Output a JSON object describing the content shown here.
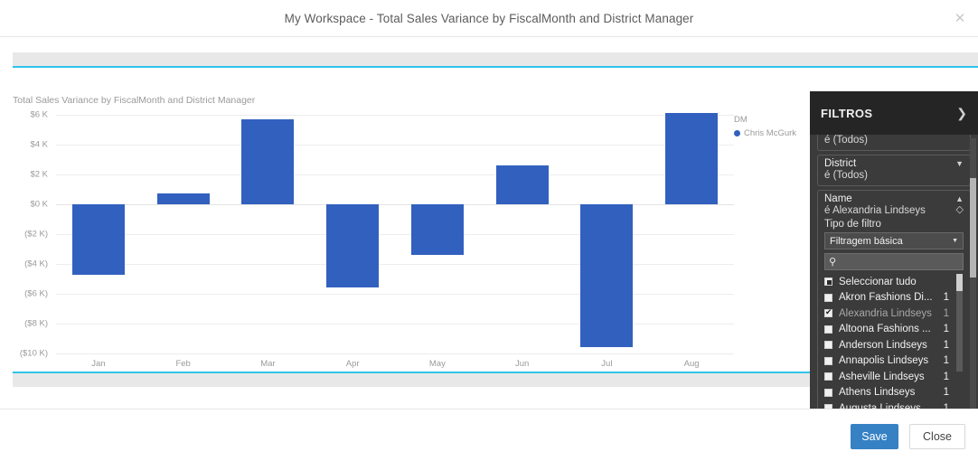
{
  "window": {
    "title": "My Workspace - Total Sales Variance by FiscalMonth and District Manager",
    "close_icon": "close-icon"
  },
  "visual": {
    "title": "Total Sales Variance by FiscalMonth and District Manager"
  },
  "chart_data": {
    "type": "bar",
    "title": "Total Sales Variance by FiscalMonth and District Manager",
    "xlabel": "",
    "ylabel": "",
    "categories": [
      "Jan",
      "Feb",
      "Mar",
      "Apr",
      "May",
      "Jun",
      "Jul",
      "Aug"
    ],
    "series": [
      {
        "name": "Chris McGurk",
        "color": "#3260bf",
        "values": [
          -4750,
          730,
          5700,
          -5550,
          -3400,
          2600,
          -9600,
          6100
        ]
      }
    ],
    "ylim": [
      -10000,
      6000
    ],
    "ytick_values": [
      6000,
      4000,
      2000,
      0,
      -2000,
      -4000,
      -6000,
      -8000,
      -10000
    ],
    "ytick_labels": [
      "$6 K",
      "$4 K",
      "$2 K",
      "$0 K",
      "($2 K)",
      "($4 K)",
      "($6 K)",
      "($8 K)",
      "($10 K)"
    ],
    "grid": true,
    "legend_position": "right",
    "legend_title": "DM",
    "legend_entries": [
      "Chris McGurk"
    ]
  },
  "filters": {
    "header_title": "FILTROS",
    "collapse_icon": "chevron-right-icon",
    "cards": [
      {
        "name": "",
        "value": "é (Todos)",
        "chevron": "",
        "clipped": true
      },
      {
        "name": "District",
        "value": "é (Todos)",
        "chevron": "chevron-down-icon",
        "clipped": false
      }
    ],
    "active_card": {
      "name": "Name",
      "value": "é Alexandria Lindseys",
      "chevron": "chevron-up-icon",
      "clear_icon": "eraser-icon",
      "filter_type_label": "Tipo de filtro",
      "filter_type_value": "Filtragem básica",
      "search_placeholder": "",
      "search_value": "",
      "search_icon": "search-icon",
      "items": [
        {
          "label": "Seleccionar tudo",
          "count": "",
          "state": "partial",
          "dim": false
        },
        {
          "label": "Akron Fashions Di...",
          "count": "1",
          "state": "unchecked",
          "dim": false
        },
        {
          "label": "Alexandria Lindseys",
          "count": "1",
          "state": "checked",
          "dim": true
        },
        {
          "label": "Altoona Fashions ...",
          "count": "1",
          "state": "unchecked",
          "dim": false
        },
        {
          "label": "Anderson Lindseys",
          "count": "1",
          "state": "unchecked",
          "dim": false
        },
        {
          "label": "Annapolis Lindseys",
          "count": "1",
          "state": "unchecked",
          "dim": false
        },
        {
          "label": "Asheville Lindseys",
          "count": "1",
          "state": "unchecked",
          "dim": false
        },
        {
          "label": "Athens Lindseys",
          "count": "1",
          "state": "unchecked",
          "dim": false
        },
        {
          "label": "Augusta Lindseys",
          "count": "1",
          "state": "unchecked",
          "dim": false
        }
      ]
    }
  },
  "footer": {
    "save_label": "Save",
    "close_label": "Close"
  },
  "colors": {
    "bar": "#3260bf",
    "accent": "#2ec5e8",
    "save_button": "#3681c4",
    "panel_bg": "#3b3b3b",
    "panel_header_bg": "#252525"
  }
}
